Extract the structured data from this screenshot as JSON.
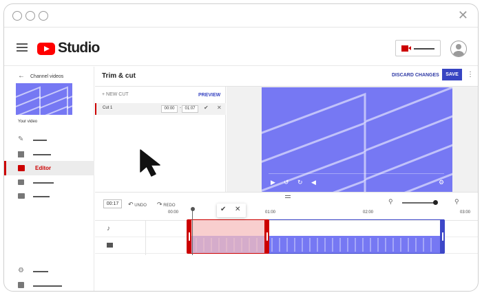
{
  "app": {
    "logo_text": "Studio"
  },
  "sidebar": {
    "back_label": "Channel videos",
    "thumb_caption": "Your video",
    "active_label": "Editor"
  },
  "header": {
    "title": "Trim & cut",
    "discard_label": "DISCARD CHANGES",
    "save_label": "SAVE"
  },
  "cuts": {
    "new_cut_label": "+ NEW CUT",
    "preview_label": "PREVIEW",
    "items": [
      {
        "name": "Cut 1",
        "start": "00:00",
        "end": "01:07"
      }
    ]
  },
  "timeline": {
    "current_time": "00:17",
    "undo_label": "UNDO",
    "redo_label": "REDO",
    "ticks": [
      "00:00",
      "01:00",
      "02:00",
      "03:00"
    ]
  },
  "colors": {
    "accent_red": "#cc0000",
    "brand_blue": "#3744c2",
    "video_blue": "#7678f3"
  }
}
